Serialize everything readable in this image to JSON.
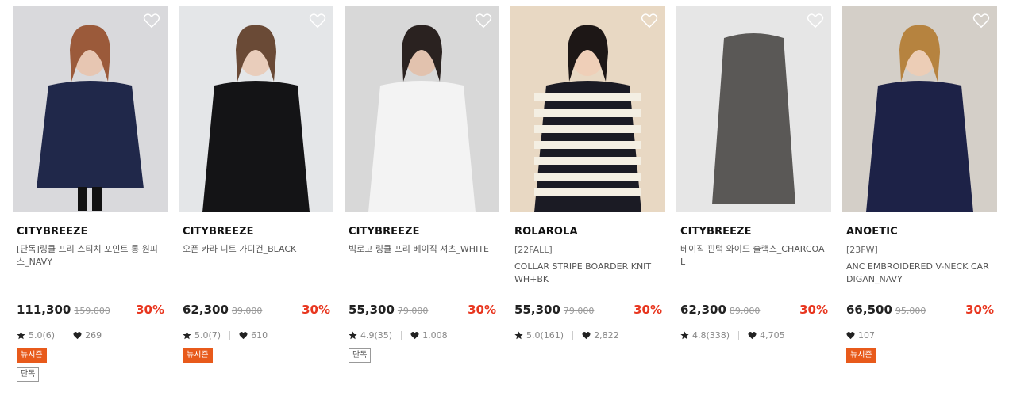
{
  "products": [
    {
      "brand": "CITYBREEZE",
      "tag": "",
      "name": "[단독]링클 프리 스티치 포인트 롱 원피스_NAVY",
      "price": "111,300",
      "original_price": "159,000",
      "discount": "30%",
      "rating": "5.0(6)",
      "likes": "269",
      "badges": [
        "뉴시즌",
        "단독"
      ],
      "colors": {
        "bg": "#d9d9dc",
        "garment": "#20284a",
        "skin": "#e7c6b2",
        "hair": "#9b5a3a"
      }
    },
    {
      "brand": "CITYBREEZE",
      "tag": "",
      "name": "오픈 카라 니트 가디건_BLACK",
      "price": "62,300",
      "original_price": "89,000",
      "discount": "30%",
      "rating": "5.0(7)",
      "likes": "610",
      "badges": [
        "뉴시즌"
      ],
      "colors": {
        "bg": "#e4e6e8",
        "garment": "#141416",
        "skin": "#e9cdbb",
        "hair": "#6a4a36"
      }
    },
    {
      "brand": "CITYBREEZE",
      "tag": "",
      "name": "빅로고 링클 프리 베이직 셔츠_WHITE",
      "price": "55,300",
      "original_price": "79,000",
      "discount": "30%",
      "rating": "4.9(35)",
      "likes": "1,008",
      "badges": [
        "단독"
      ],
      "colors": {
        "bg": "#d8d8d8",
        "garment": "#f3f3f3",
        "skin": "#e2c2ae",
        "hair": "#2a2220"
      }
    },
    {
      "brand": "ROLAROLA",
      "tag": "[22FALL]",
      "name": "COLLAR STRIPE BOARDER KNIT WH+BK",
      "price": "55,300",
      "original_price": "79,000",
      "discount": "30%",
      "rating": "5.0(161)",
      "likes": "2,822",
      "badges": [],
      "colors": {
        "bg": "#e8d8c3",
        "garment": "#1b1b24",
        "skin": "#efcfb8",
        "hair": "#1d1716"
      }
    },
    {
      "brand": "CITYBREEZE",
      "tag": "",
      "name": "베이직 핀턱 와이드 슬랙스_CHARCOAL",
      "price": "62,300",
      "original_price": "89,000",
      "discount": "30%",
      "rating": "4.8(338)",
      "likes": "4,705",
      "badges": [],
      "colors": {
        "bg": "#e6e6e6",
        "garment": "#5a5856",
        "skin": "#e7c9b5",
        "hair": "#ffffff"
      }
    },
    {
      "brand": "ANOETIC",
      "tag": "[23FW]",
      "name": "ANC EMBROIDERED V-NECK CARDIGAN_NAVY",
      "price": "66,500",
      "original_price": "95,000",
      "discount": "30%",
      "rating": "",
      "likes": "107",
      "badges": [
        "뉴시즌"
      ],
      "colors": {
        "bg": "#d4cfc8",
        "garment": "#1d2247",
        "skin": "#eccdb6",
        "hair": "#b6833f"
      }
    }
  ]
}
